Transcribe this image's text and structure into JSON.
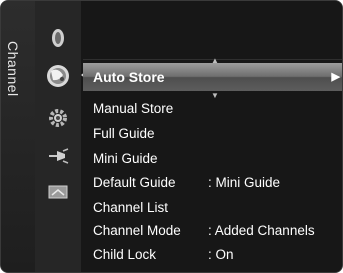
{
  "sidebar": {
    "label": "Channel",
    "icons": [
      "picture-icon",
      "channel-satellite-icon",
      "setup-gear-icon",
      "input-plug-icon",
      "application-icon"
    ]
  },
  "menu": {
    "items": [
      {
        "label": "Auto Store",
        "value": "",
        "selected": true
      },
      {
        "label": "Manual Store",
        "value": ""
      },
      {
        "label": "Full Guide",
        "value": ""
      },
      {
        "label": "Mini Guide",
        "value": ""
      },
      {
        "label": "Default Guide",
        "value": ": Mini Guide"
      },
      {
        "label": "Channel List",
        "value": ""
      },
      {
        "label": "Channel Mode",
        "value": ": Added Channels"
      },
      {
        "label": "Child Lock",
        "value": ": On"
      }
    ]
  },
  "colors": {
    "background": "#171717",
    "highlight": "#8a8a8a",
    "text": "#ffffff"
  }
}
